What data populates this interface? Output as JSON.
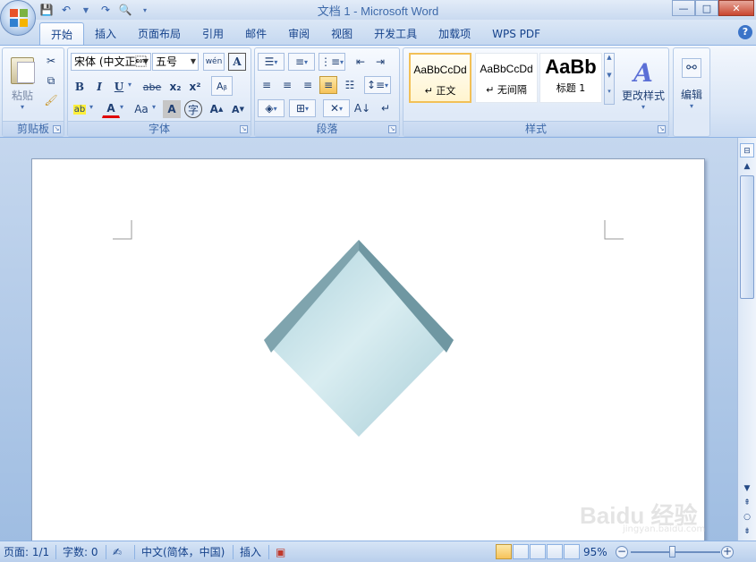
{
  "window": {
    "title": "文档 1 - Microsoft Word",
    "minimize": "—",
    "maximize": "□",
    "close": "✕"
  },
  "tabs": [
    {
      "label": "开始",
      "active": true
    },
    {
      "label": "插入"
    },
    {
      "label": "页面布局"
    },
    {
      "label": "引用"
    },
    {
      "label": "邮件"
    },
    {
      "label": "审阅"
    },
    {
      "label": "视图"
    },
    {
      "label": "开发工具"
    },
    {
      "label": "加载项"
    },
    {
      "label": "WPS PDF"
    }
  ],
  "help": "?",
  "groups": {
    "clipboard": {
      "label": "剪贴板",
      "paste": "粘贴"
    },
    "font": {
      "label": "字体",
      "font_name": "宋体 (中文正\u0004",
      "font_size": "五号",
      "bold": "B",
      "italic": "I",
      "underline": "U",
      "strike": "abe",
      "subscript": "x₂",
      "superscript": "x²",
      "change_case": "Aa",
      "grow": "A",
      "shrink": "A",
      "char_shade": "A",
      "pinyin": "wén"
    },
    "paragraph": {
      "label": "段落"
    },
    "styles": {
      "label": "样式",
      "items": [
        {
          "sample": "AaBbCcDd",
          "name": "↵ 正文",
          "active": true
        },
        {
          "sample": "AaBbCcDd",
          "name": "↵ 无间隔"
        },
        {
          "sample": "AaBb",
          "name": "标题 1"
        }
      ],
      "change_styles": "更改样式"
    },
    "editing": {
      "label": "编辑"
    }
  },
  "statusbar": {
    "page": "页面: 1/1",
    "words": "字数: 0",
    "language": "中文(简体，中国)",
    "mode": "插入",
    "zoom": "95%",
    "zoom_level": 0.46
  },
  "watermark": {
    "text": "Baidu 经验",
    "url": "jingyan.baidu.com"
  },
  "colors": {
    "accent": "#15428b",
    "diamond_face": "#c7e3ea",
    "diamond_edge": "#7fa4ae"
  },
  "icons": [
    "office-logo",
    "save-icon",
    "undo-icon",
    "redo-icon",
    "print-preview-icon",
    "scissors-icon",
    "copy-icon",
    "format-painter-icon",
    "search-binoculars-icon"
  ]
}
